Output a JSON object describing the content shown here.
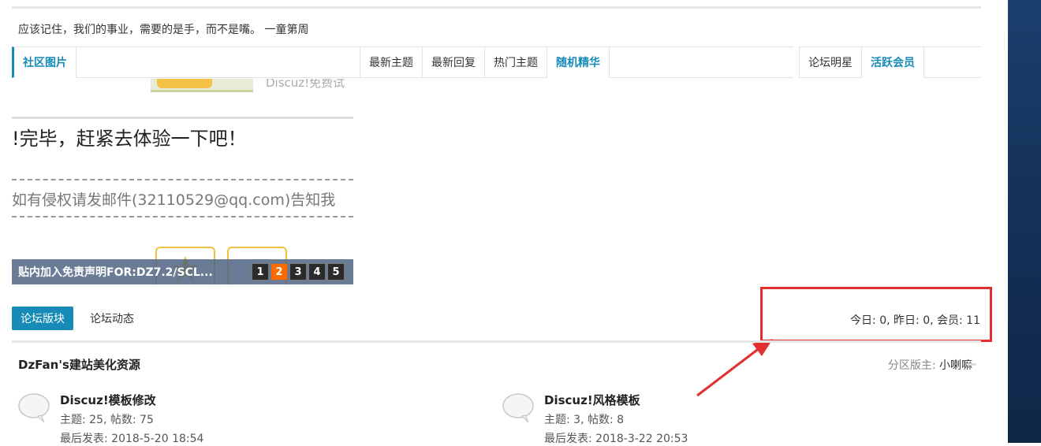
{
  "quote": "应该记住，我们的事业，需要的是手，而不是嘴。 一童第周",
  "tabs_left": [
    "社区图片"
  ],
  "tabs_middle": [
    "最新主题",
    "最新回复",
    "热门主题",
    "随机精华"
  ],
  "tabs_right": [
    "论坛明星",
    "活跃会员"
  ],
  "slideshow": {
    "logo_text": "Discuz!免费试",
    "big_text": "!完毕，赶紧去体验一下吧！",
    "mail_text": "如有侵权请发邮件(32110529@qq.com)告知我",
    "caption": "贴内加入免责声明FOR:DZ7.2/SCL...",
    "pages": [
      "1",
      "2",
      "3",
      "4",
      "5"
    ],
    "active_page": "2"
  },
  "forum_tabs": {
    "active": "论坛版块",
    "other": "论坛动态"
  },
  "stats": "今日: 0, 昨日: 0, 会员: 11",
  "group": {
    "title": "DzFan's建站美化资源",
    "moderator_label": "分区版主:",
    "moderator_name": "小喇嘛"
  },
  "forums": [
    {
      "name": "Discuz!模板修改",
      "stat": "主题: 25, 帖数: 75",
      "last": "最后发表: 2018-5-20 18:54"
    },
    {
      "name": "Discuz!风格模板",
      "stat": "主题: 3, 帖数: 8",
      "last": "最后发表: 2018-3-22 20:53"
    }
  ],
  "colors": {
    "accent": "#168bb8",
    "highlight": "#e03030",
    "active_page": "#ff6a00"
  }
}
